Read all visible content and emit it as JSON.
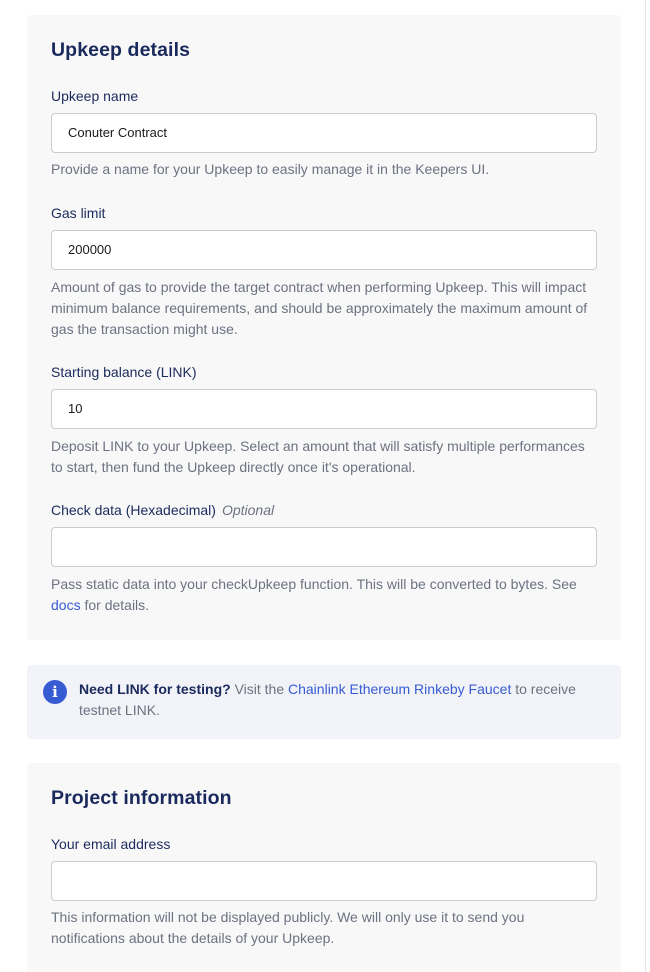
{
  "upkeep_details": {
    "title": "Upkeep details",
    "name_field": {
      "label": "Upkeep name",
      "value": "Conuter Contract",
      "help": "Provide a name for your Upkeep to easily manage it in the Keepers UI."
    },
    "gas_limit_field": {
      "label": "Gas limit",
      "value": "200000",
      "help": "Amount of gas to provide the target contract when performing Upkeep. This will impact minimum balance requirements, and should be approximately the maximum amount of gas the transaction might use."
    },
    "starting_balance_field": {
      "label": "Starting balance (LINK)",
      "value": "10",
      "help": "Deposit LINK to your Upkeep. Select an amount that will satisfy multiple performances to start, then fund the Upkeep directly once it's operational."
    },
    "check_data_field": {
      "label": "Check data (Hexadecimal)",
      "optional_label": "Optional",
      "value": "",
      "help_before": "Pass static data into your checkUpkeep function. This will be converted to bytes. See",
      "help_link": "docs",
      "help_after": "for details."
    }
  },
  "info_banner": {
    "icon": "info-icon",
    "icon_glyph": "i",
    "strong_text": "Need LINK for testing?",
    "text_before": "Visit the",
    "link_text": "Chainlink Ethereum Rinkeby Faucet",
    "text_after": "to receive testnet LINK."
  },
  "project_information": {
    "title": "Project information",
    "email_field": {
      "label": "Your email address",
      "value": "",
      "help": "This information will not be displayed publicly. We will only use it to send you notifications about the details of your Upkeep."
    }
  },
  "colors": {
    "heading": "#1b2a5c",
    "link": "#375bd2",
    "muted_text": "#6c7280",
    "card_background": "#f8f8f9",
    "info_background": "#f1f3f8"
  }
}
